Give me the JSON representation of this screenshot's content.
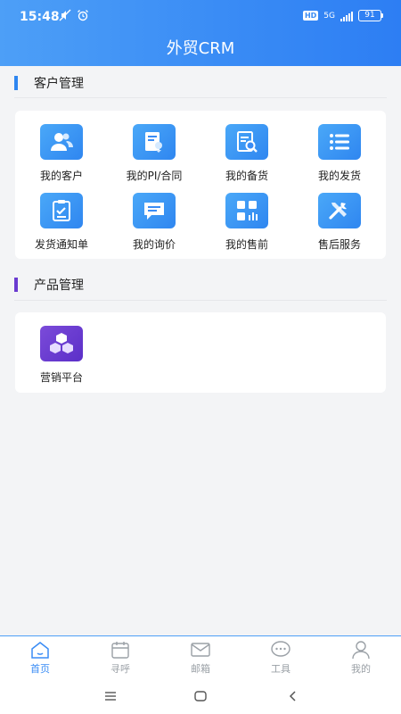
{
  "status_bar": {
    "time": "15:48",
    "hd": "HD",
    "network": "5G",
    "battery": "91"
  },
  "app": {
    "title": "外贸CRM"
  },
  "sections": {
    "customer": {
      "title": "客户管理",
      "accent": "#2f86f0",
      "items": [
        {
          "label": "我的客户",
          "icon": "customers-icon"
        },
        {
          "label": "我的PI/合同",
          "icon": "contract-icon"
        },
        {
          "label": "我的备货",
          "icon": "stock-search-icon"
        },
        {
          "label": "我的发货",
          "icon": "shipment-list-icon"
        },
        {
          "label": "发货通知单",
          "icon": "clipboard-check-icon"
        },
        {
          "label": "我的询价",
          "icon": "inquiry-chat-icon"
        },
        {
          "label": "我的售前",
          "icon": "presale-grid-icon"
        },
        {
          "label": "售后服务",
          "icon": "tools-icon"
        }
      ]
    },
    "product": {
      "title": "产品管理",
      "accent": "#6a3bd0",
      "items": [
        {
          "label": "营销平台",
          "icon": "cubes-icon"
        }
      ]
    }
  },
  "tabs": [
    {
      "label": "首页",
      "icon": "home-icon",
      "active": true
    },
    {
      "label": "寻呼",
      "icon": "calendar-icon",
      "active": false
    },
    {
      "label": "邮箱",
      "icon": "mail-icon",
      "active": false
    },
    {
      "label": "工具",
      "icon": "chat-tools-icon",
      "active": false
    },
    {
      "label": "我的",
      "icon": "user-icon",
      "active": false
    }
  ],
  "colors": {
    "primary": "#3a8cf5",
    "inactive": "#9aa0a6"
  }
}
